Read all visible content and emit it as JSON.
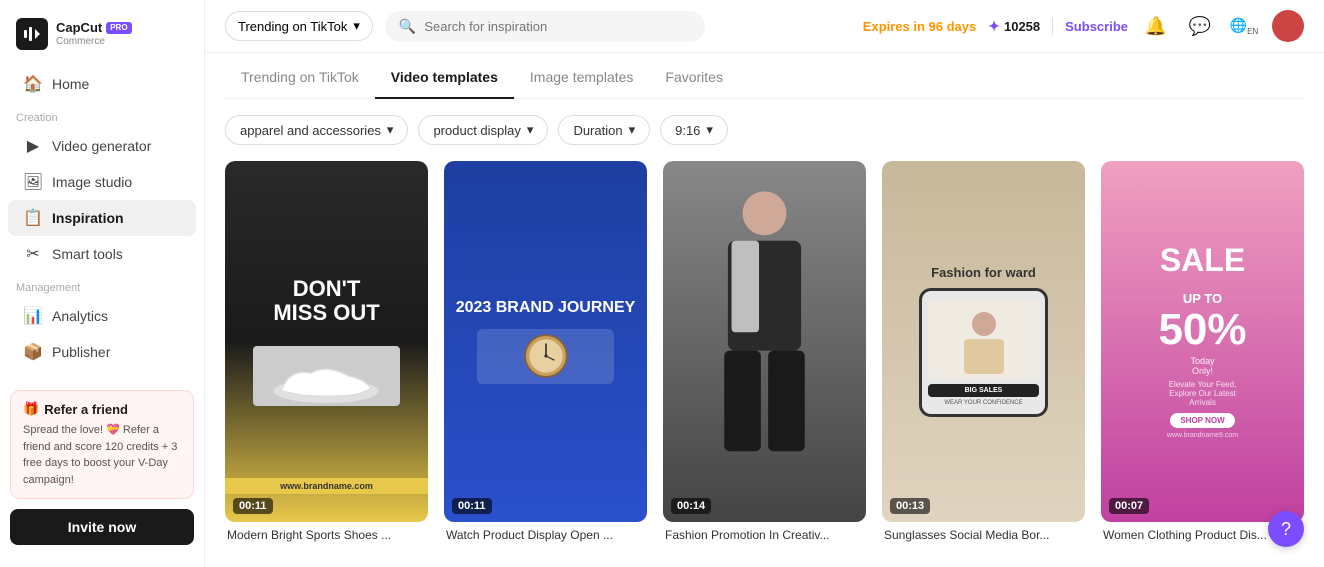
{
  "brand": {
    "name_main": "CapCut",
    "name_sub": "Commerce",
    "pro_badge": "PRO"
  },
  "sidebar": {
    "home_label": "Home",
    "creation_section": "Creation",
    "items_creation": [
      {
        "id": "video-generator",
        "label": "Video generator",
        "icon": "▶"
      },
      {
        "id": "image-studio",
        "label": "Image studio",
        "icon": "🖼"
      },
      {
        "id": "inspiration",
        "label": "Inspiration",
        "icon": "📋",
        "active": true
      }
    ],
    "smart_tools_label": "Smart tools",
    "management_section": "Management",
    "items_management": [
      {
        "id": "analytics",
        "label": "Analytics",
        "icon": "📊"
      },
      {
        "id": "publisher",
        "label": "Publisher",
        "icon": "📦"
      }
    ],
    "refer_title": "Refer a friend",
    "refer_emoji": "🎁",
    "refer_text": "Spread the love! 💝 Refer a friend and score 120 credits + 3 free days to boost your V-Day campaign!",
    "invite_label": "Invite now"
  },
  "topbar": {
    "trending_label": "Trending on TikTok",
    "search_placeholder": "Search for inspiration",
    "expires_text": "Expires in 96 days",
    "credits": "10258",
    "subscribe_label": "Subscribe"
  },
  "tabs": [
    {
      "id": "trending-tiktok",
      "label": "Trending on TikTok",
      "active": false
    },
    {
      "id": "video-templates",
      "label": "Video templates",
      "active": true
    },
    {
      "id": "image-templates",
      "label": "Image templates",
      "active": false
    },
    {
      "id": "favorites",
      "label": "Favorites",
      "active": false
    }
  ],
  "filters": [
    {
      "id": "category",
      "label": "apparel and accessories"
    },
    {
      "id": "type",
      "label": "product display"
    },
    {
      "id": "duration",
      "label": "Duration"
    },
    {
      "id": "ratio",
      "label": "9:16"
    }
  ],
  "videos": [
    {
      "id": "v1",
      "title": "Modern Bright Sports Shoes ...",
      "duration": "00:11",
      "bg": "#1a1a1a",
      "thumb_type": "sports-shoes"
    },
    {
      "id": "v2",
      "title": "Watch Product Display Open ...",
      "duration": "00:11",
      "bg": "#1e3fa0",
      "thumb_type": "brand-journey"
    },
    {
      "id": "v3",
      "title": "Fashion Promotion In Creativ...",
      "duration": "00:14",
      "bg": "#555",
      "thumb_type": "fashion"
    },
    {
      "id": "v4",
      "title": "Sunglasses Social Media Bor...",
      "duration": "00:13",
      "bg": "#c8b89a",
      "thumb_type": "sunglasses"
    },
    {
      "id": "v5",
      "title": "Women Clothing Product Dis...",
      "duration": "00:07",
      "bg": "#f080b0",
      "thumb_type": "sale"
    }
  ],
  "help_icon": "?"
}
